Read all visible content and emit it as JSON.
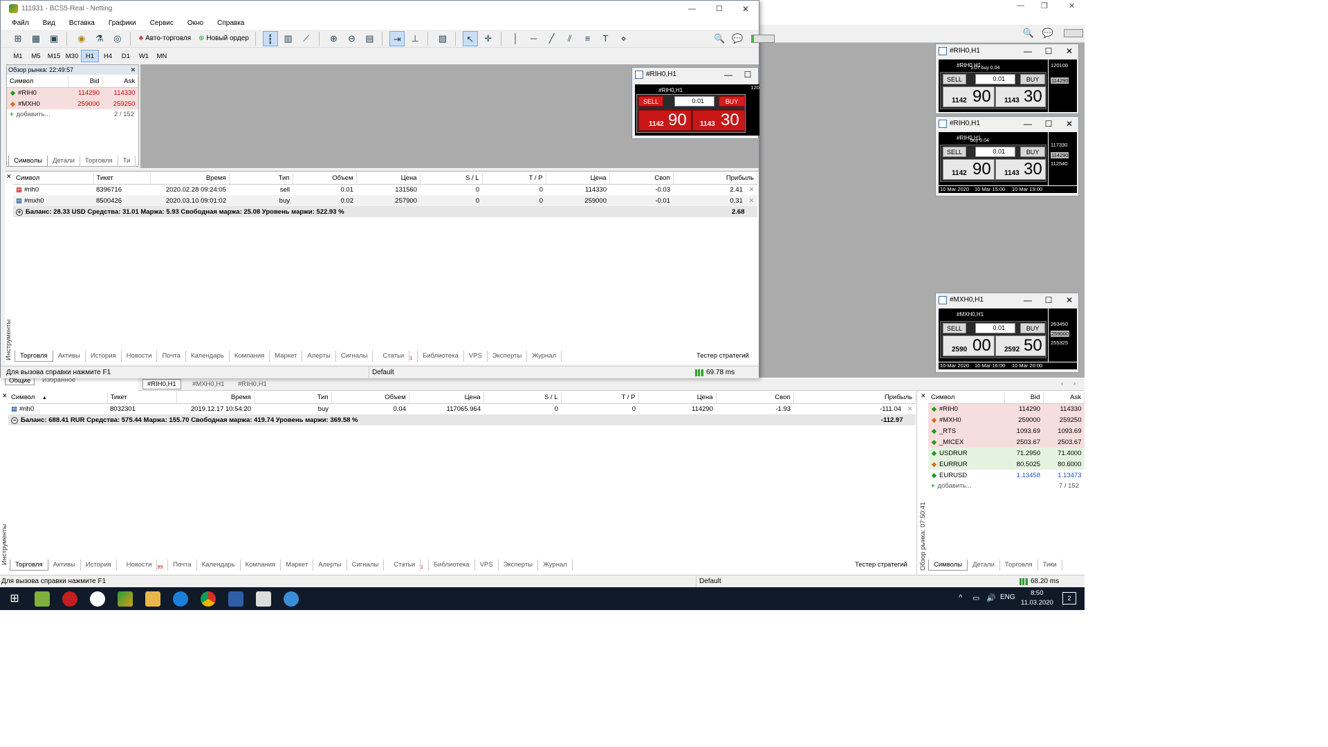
{
  "window": {
    "title": "111931 - BCS5-Real - Netting",
    "min": "—",
    "max": "☐",
    "close": "✕"
  },
  "menu": [
    "Файл",
    "Вид",
    "Вставка",
    "Графики",
    "Сервис",
    "Окно",
    "Справка"
  ],
  "toolbar": {
    "auto_trading": "Авто-торговля",
    "new_order": "Новый ордер"
  },
  "timeframes": [
    "M1",
    "M5",
    "M15",
    "M30",
    "H1",
    "H4",
    "D1",
    "W1",
    "MN"
  ],
  "active_timeframe": "H1",
  "market_watch_small": {
    "title": "Обзор рынка: 22:49:57",
    "headers": [
      "Символ",
      "Bid",
      "Ask"
    ],
    "rows": [
      {
        "symbol": "#RIH0",
        "bid": "114290",
        "ask": "114330",
        "dir": "up"
      },
      {
        "symbol": "#MXH0",
        "bid": "259000",
        "ask": "259250",
        "dir": "down"
      }
    ],
    "add": "добавить...",
    "count": "2 / 152",
    "tabs": [
      "Символы",
      "Детали",
      "Торговля",
      "Ти"
    ]
  },
  "chart_window_inner": {
    "title": "#RIH0,H1",
    "label": "#RIH0,H1",
    "sell": "SELL",
    "buy": "BUY",
    "lot": "0.01",
    "sell_small": "1142",
    "sell_big": "90",
    "buy_small": "1143",
    "buy_big": "30",
    "axis_top": "120"
  },
  "trade_top": {
    "headers": [
      "Символ",
      "Тикет",
      "Время",
      "Тип",
      "Объем",
      "Цена",
      "S / L",
      "T / P",
      "Цена",
      "Своп",
      "Прибыль"
    ],
    "rows": [
      [
        "#rih0",
        "8396716",
        "2020.02.28 09:24:05",
        "sell",
        "0.01",
        "131560",
        "0",
        "0",
        "114330",
        "-0.03",
        "2.41"
      ],
      [
        "#mxh0",
        "8500426",
        "2020.03.10 09:01:02",
        "buy",
        "0.02",
        "257900",
        "0",
        "0",
        "259000",
        "-0.01",
        "0.31"
      ]
    ],
    "summary": "Баланс: 28.33 USD  Средства: 31.01  Маржа: 5.93  Свободная маржа: 25.08  Уровень маржи: 522.93 %",
    "summary_profit": "2.68",
    "tabs": [
      "Торговля",
      "Активы",
      "История",
      "Новости",
      "Почта",
      "Календарь",
      "Компания",
      "Маркет",
      "Алерты",
      "Сигналы",
      "Статьи",
      "Библиотека",
      "VPS",
      "Эксперты",
      "Журнал"
    ],
    "strategy_tester": "Тестер стратегий",
    "side_label": "Инструменты"
  },
  "status_top": {
    "help": "Для вызова справки нажмите F1",
    "profile": "Default",
    "ping": "69.78 ms"
  },
  "tabs_general": [
    "Общие",
    "Избранное"
  ],
  "chart_tabs": [
    "#RIH0,H1",
    "#MXH0,H1",
    "#RIH0,H1"
  ],
  "trade_bottom": {
    "headers": [
      "Символ",
      "Тикет",
      "Время",
      "Тип",
      "Объем",
      "Цена",
      "S / L",
      "T / P",
      "Цена",
      "Своп",
      "Прибыль"
    ],
    "rows": [
      [
        "#rih0",
        "8032301",
        "2019.12.17 10:54:20",
        "buy",
        "0.04",
        "117065.964",
        "0",
        "0",
        "114290",
        "-1.93",
        "-111.04"
      ]
    ],
    "summary": "Баланс: 688.41 RUR  Средства: 575.44  Маржа: 155.70  Свободная маржа: 419.74  Уровень маржи: 369.58 %",
    "summary_profit": "-112.97",
    "tabs": [
      "Торговля",
      "Активы",
      "История",
      "Новости",
      "Почта",
      "Календарь",
      "Компания",
      "Маркет",
      "Алерты",
      "Сигналы",
      "Статьи",
      "Библиотека",
      "VPS",
      "Эксперты",
      "Журнал"
    ],
    "news_badge": "99",
    "articles_badge": "1",
    "strategy_tester": "Тестер стратегий",
    "side_label": "Инструменты"
  },
  "market_watch_big": {
    "headers": [
      "Символ",
      "Bid",
      "Ask"
    ],
    "rows": [
      {
        "symbol": "#RIH0",
        "bid": "114290",
        "ask": "114330",
        "dir": "up",
        "style": "pink"
      },
      {
        "symbol": "#MXH0",
        "bid": "259000",
        "ask": "259250",
        "dir": "down",
        "style": "pink"
      },
      {
        "symbol": "_RTS",
        "bid": "1093.69",
        "ask": "1093.69",
        "dir": "up",
        "style": "pink"
      },
      {
        "symbol": "_MICEX",
        "bid": "2503.67",
        "ask": "2503.67",
        "dir": "up",
        "style": "pink"
      },
      {
        "symbol": "USDRUR",
        "bid": "71.2950",
        "ask": "71.4000",
        "dir": "up",
        "style": "green"
      },
      {
        "symbol": "EURRUR",
        "bid": "80.5025",
        "ask": "80.6000",
        "dir": "down",
        "style": "green"
      },
      {
        "symbol": "EURUSD",
        "bid": "1.13458",
        "ask": "1.13473",
        "dir": "up",
        "style": "white"
      }
    ],
    "add": "добавить...",
    "count": "7 / 152",
    "side_label": "Обзор рынка: 07:50:41",
    "tabs": [
      "Символы",
      "Детали",
      "Торговля",
      "Тики"
    ]
  },
  "status_bottom": {
    "help": "Для вызова справки нажмите F1",
    "profile": "Default",
    "ping": "68.20 ms"
  },
  "mini1": {
    "title": "#RIH0,H1",
    "label": "#RIH0,H1",
    "sub": "1.07 buy 0.04",
    "sell": "SELL",
    "buy": "BUY",
    "lot": "0.01",
    "sell_small": "1142",
    "sell_big": "90",
    "buy_small": "1143",
    "buy_big": "30",
    "axis": [
      "120100",
      "114290"
    ]
  },
  "mini2": {
    "title": "#RIH0,H1",
    "label": "#RIH0,H1",
    "sub": "buy 0.04",
    "sell": "SELL",
    "buy": "BUY",
    "lot": "0.01",
    "sell_small": "1142",
    "sell_big": "90",
    "buy_small": "1143",
    "buy_big": "30",
    "axis": [
      "117330",
      "114290",
      "112540"
    ],
    "xaxis": [
      "10 Mar 2020",
      "10 Mar 15:00",
      "10 Mar 19:00"
    ]
  },
  "mini3": {
    "title": "#MXH0,H1",
    "label": "#MXH0,H1",
    "sell": "SELL",
    "buy": "BUY",
    "lot": "0.01",
    "sell_small": "2590",
    "sell_big": "00",
    "buy_small": "2592",
    "buy_big": "50",
    "axis": [
      "263450",
      "259000",
      "255325"
    ],
    "xaxis": [
      "10 Mar 2020",
      "10 Mar 16:00",
      "10 Mar 20:00"
    ]
  },
  "taskbar": {
    "lang": "ENG",
    "time": "8:50",
    "date": "11.03.2020",
    "notif": "2"
  },
  "colors": {
    "sell_red": "#d51b1b",
    "pink_row": "#f6dede",
    "green_row": "#e4f3e0",
    "taskbar": "#101a28"
  }
}
